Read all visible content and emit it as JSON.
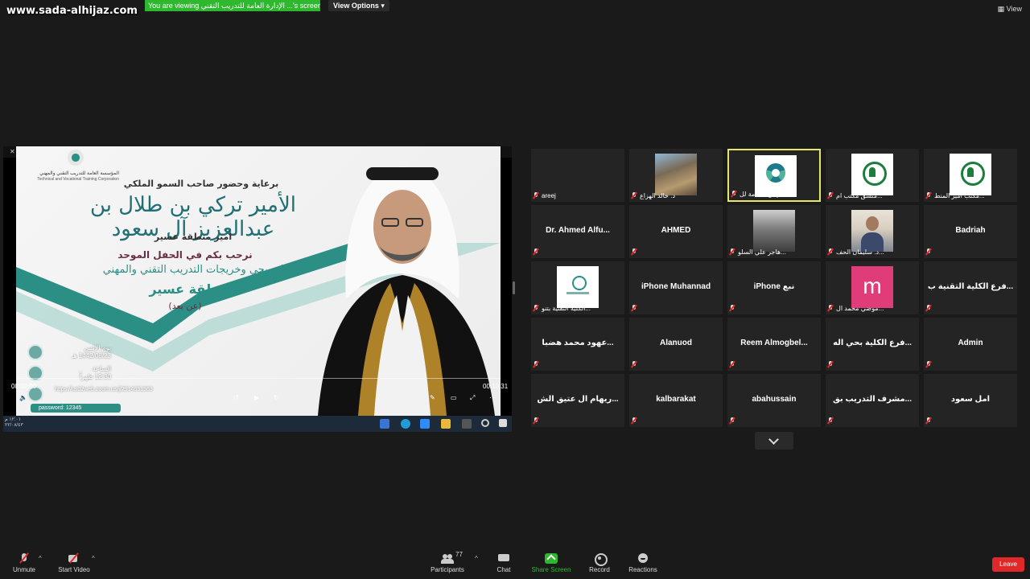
{
  "watermark": "www.sada-alhijaz.com",
  "banner": {
    "viewing_text": "You are viewing الإدارة العامة للتدريب التقني ...'s screen",
    "view_options": "View Options ▾",
    "view_label": "View"
  },
  "slide": {
    "org_ar": "المؤسسة العامة للتدريب التقني والمهني",
    "org_en": "Technical and Vocational Training Corporation",
    "patron": "برعاية وحضور صاحب السمو الملكي",
    "name": "الأمير تركي بن طلال بن عبدالعزيز آل سعود",
    "title": "أمير منطقة عسير",
    "welcome": "نرحب بكم في الحفل الموحد",
    "grads": "لخريجي وخريجات التدريب التقني والمهني",
    "region": "بمنطقة عسير",
    "remote": "(عن بعد)",
    "day_label": "يوم الإثنين",
    "date": "1442/08/23 هـ",
    "time_label": "الساعة",
    "time": "12:30 ظهراً",
    "url": "https://us02web.zoom.us/j/2914651563",
    "password": "password: 12345"
  },
  "video_controls": {
    "time_start": "00:00:00",
    "time_end": "00:10:31"
  },
  "taskbar": {
    "clock_time": "١٢:٠١ م",
    "clock_date": "٢٢/٠٨/٤٣"
  },
  "participants_tiles": [
    {
      "name": "areej",
      "center": "",
      "thumb": ""
    },
    {
      "name": "د. خالد الهزاع",
      "center": "",
      "thumb": "photo-rock"
    },
    {
      "name": "الإدارة العامة لل...",
      "center": "",
      "thumb": "tvtc",
      "active": true
    },
    {
      "name": "منسق مكتب ام...",
      "center": "",
      "thumb": "emblem"
    },
    {
      "name": "مكتب امير المنط...",
      "center": "",
      "thumb": "emblem"
    },
    {
      "name": "",
      "center": "Dr. Ahmed Alfu...",
      "thumb": ""
    },
    {
      "name": "",
      "center": "AHMED",
      "thumb": ""
    },
    {
      "name": "هاجر علي السلو...",
      "center": "",
      "thumb": "photo-bw"
    },
    {
      "name": "د. سليمان الحف...",
      "center": "",
      "thumb": "photo-man"
    },
    {
      "name": "",
      "center": "Badriah",
      "thumb": ""
    },
    {
      "name": "الكلية التقنية بتنو...",
      "center": "",
      "thumb": "leaf"
    },
    {
      "name": "",
      "center": "iPhone Muhannad",
      "thumb": ""
    },
    {
      "name": "",
      "center": "iPhone نبع",
      "thumb": ""
    },
    {
      "name": "موضي محمد ال...",
      "center": "",
      "thumb": "m"
    },
    {
      "name": "",
      "center": "فرع الكلية التقنية ب...",
      "thumb": ""
    },
    {
      "name": "",
      "center": "عهود محمد هضبا...",
      "thumb": ""
    },
    {
      "name": "",
      "center": "Alanuod",
      "thumb": ""
    },
    {
      "name": "",
      "center": "Reem Almogbel...",
      "thumb": ""
    },
    {
      "name": "",
      "center": "فرع الكلية بحي اله...",
      "thumb": ""
    },
    {
      "name": "",
      "center": "Admin",
      "thumb": ""
    },
    {
      "name": "",
      "center": "ريهام ال عتيق الش...",
      "thumb": ""
    },
    {
      "name": "",
      "center": "kalbarakat",
      "thumb": ""
    },
    {
      "name": "",
      "center": "abahussain",
      "thumb": ""
    },
    {
      "name": "",
      "center": "مشرف التدريب بق...",
      "thumb": ""
    },
    {
      "name": "",
      "center": "امل سعود",
      "thumb": ""
    }
  ],
  "toolbar": {
    "unmute": "Unmute",
    "start_video": "Start Video",
    "participants": "Participants",
    "participants_count": "77",
    "chat": "Chat",
    "share_screen": "Share Screen",
    "record": "Record",
    "reactions": "Reactions",
    "leave": "Leave"
  },
  "colors": {
    "share_green": "#2eb82e",
    "leave_red": "#e02828",
    "active_speaker": "#e6e66a",
    "teal": "#2c8f86"
  }
}
